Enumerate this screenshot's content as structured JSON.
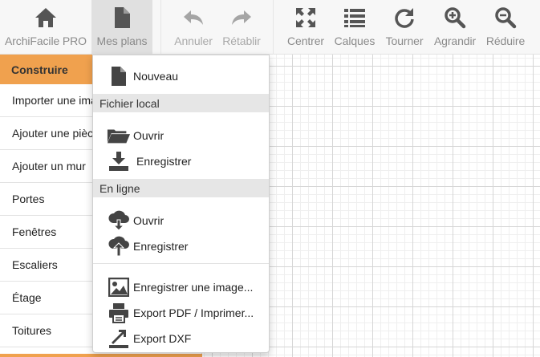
{
  "toolbar": {
    "items": [
      {
        "label": "ArchiFacile PRO",
        "icon": "home-icon"
      },
      {
        "label": "Mes plans",
        "icon": "document-icon"
      },
      {
        "label": "Annuler",
        "icon": "undo-icon"
      },
      {
        "label": "Rétablir",
        "icon": "redo-icon"
      },
      {
        "label": "Centrer",
        "icon": "expand-icon"
      },
      {
        "label": "Calques",
        "icon": "layers-icon"
      },
      {
        "label": "Tourner",
        "icon": "rotate-icon"
      },
      {
        "label": "Agrandir",
        "icon": "zoom-in-icon"
      },
      {
        "label": "Réduire",
        "icon": "zoom-out-icon"
      }
    ]
  },
  "sidebar": {
    "header": "Construire",
    "items": [
      {
        "label": "Importer une image"
      },
      {
        "label": "Ajouter une pièce"
      },
      {
        "label": "Ajouter un mur"
      },
      {
        "label": "Portes"
      },
      {
        "label": "Fenêtres"
      },
      {
        "label": "Escaliers"
      },
      {
        "label": "Étage"
      },
      {
        "label": "Toitures"
      }
    ]
  },
  "menu": {
    "new": "Nouveau",
    "local_header": "Fichier local",
    "local_open": "Ouvrir",
    "local_save": "Enregistrer",
    "online_header": "En ligne",
    "online_open": "Ouvrir",
    "online_save": "Enregistrer",
    "save_image": "Enregistrer une image...",
    "export_pdf": "Export PDF / Imprimer...",
    "export_dxf": "Export DXF"
  },
  "colors": {
    "accent": "#f0a14e",
    "icon_dark": "#555555",
    "icon_dim": "#a5a5a5",
    "menu_header_bg": "#e6e6e6"
  }
}
